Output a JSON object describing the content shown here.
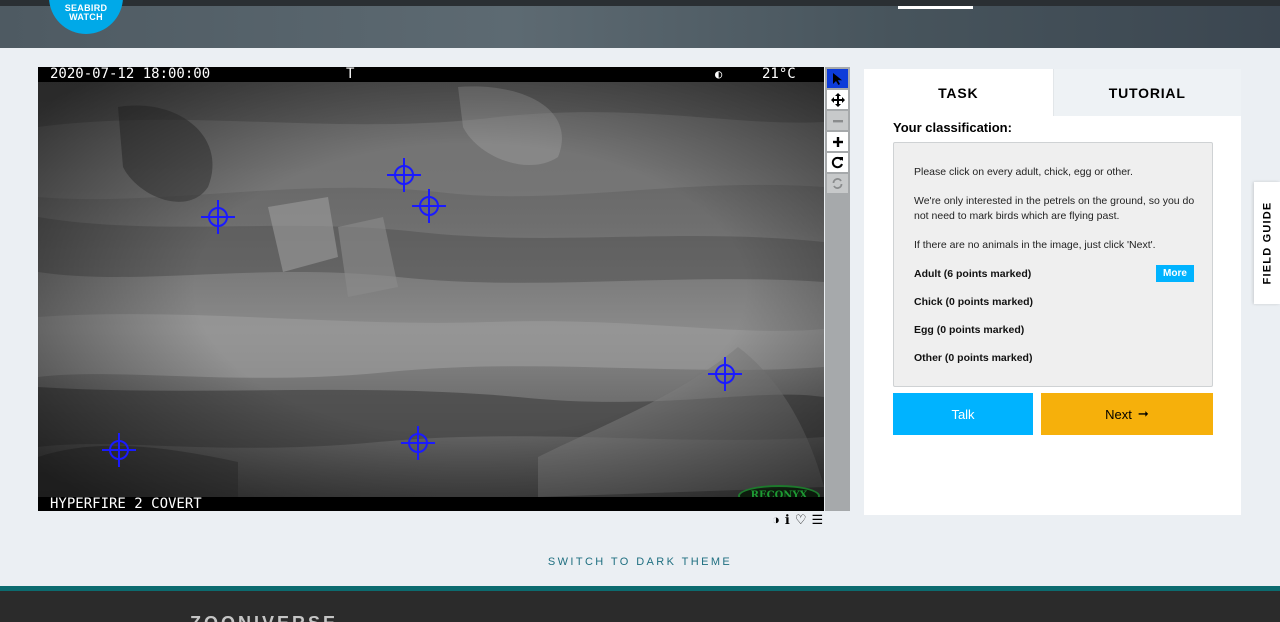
{
  "header": {
    "logo_line1": "SEABIRD",
    "logo_line2": "WATCH"
  },
  "camera": {
    "datetime": "2020-07-12 18:00:00",
    "flag": "T",
    "moon_icon": "◐",
    "temperature": "21°C",
    "model": "HYPERFIRE 2 COVERT",
    "brand": "RECONYX"
  },
  "toolbar": {
    "icons": [
      "pointer-icon",
      "move-icon",
      "zoom-out-icon",
      "zoom-in-icon",
      "rotate-icon",
      "reset-icon"
    ]
  },
  "meta_icons": {
    "invert": "◑",
    "info": "ℹ",
    "favorite": "♡",
    "collect": "☰"
  },
  "panel": {
    "tabs": [
      {
        "label": "TASK"
      },
      {
        "label": "TUTORIAL"
      }
    ],
    "heading": "Your classification:",
    "instructions": [
      "Please click on every adult, chick, egg or other.",
      "We're only interested in the petrels on the ground, so you do not need to mark birds which are flying past.",
      "If there are no animals in the image, just click 'Next'."
    ],
    "options": [
      {
        "label": "Adult (6 points marked)"
      },
      {
        "label": "Chick (0 points marked)"
      },
      {
        "label": "Egg (0 points marked)"
      },
      {
        "label": "Other (0 points marked)"
      }
    ],
    "more_label": "More",
    "talk_label": "Talk",
    "next_label": "Next",
    "next_arrow": "➞"
  },
  "field_guide_label": "FIELD GUIDE",
  "theme_switch_label": "SWITCH TO DARK THEME",
  "footer": {
    "logo_text": "ZOONIVERSE"
  },
  "colors": {
    "accent_blue": "#00b3ff",
    "next_orange": "#f6b00b",
    "marker_blue": "#1a1aff"
  }
}
